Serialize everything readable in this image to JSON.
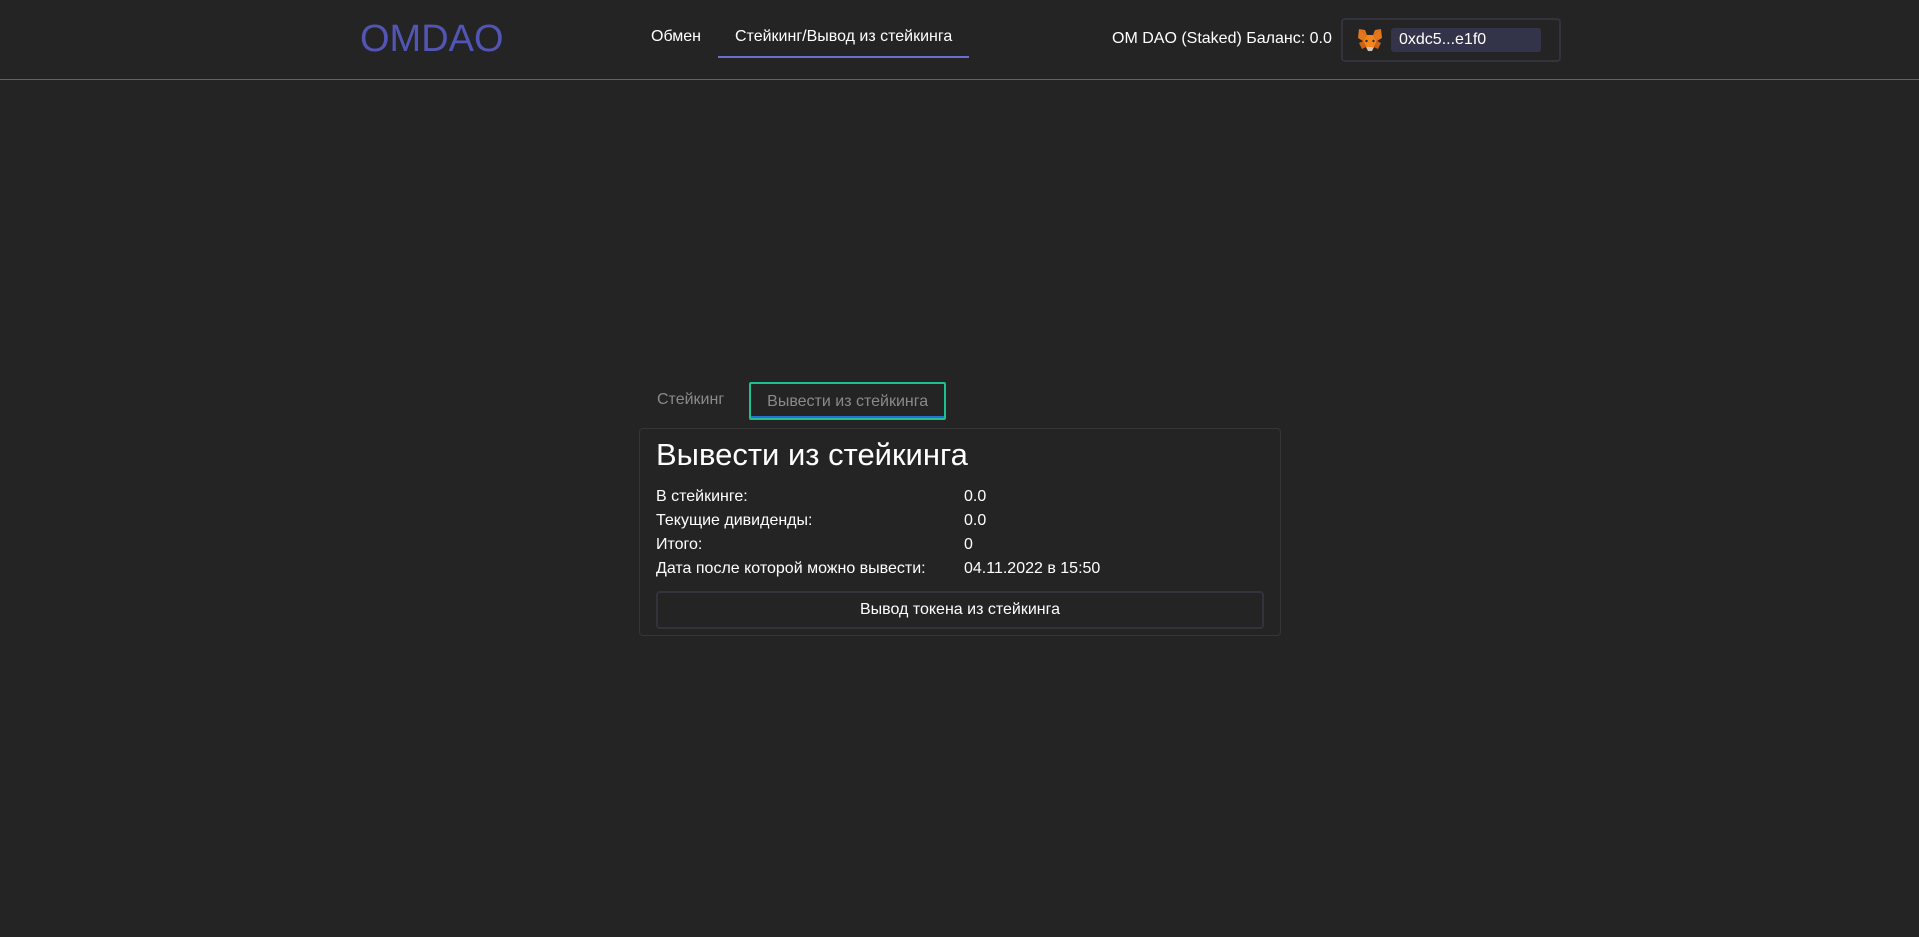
{
  "header": {
    "logo": "OMDAO",
    "nav": [
      {
        "label": "Обмен"
      },
      {
        "label": "Стейкинг/Вывод из стейкинга"
      }
    ],
    "balance_text": "OM DAO (Staked) Баланс: 0.0",
    "wallet": {
      "icon": "metamask-fox-icon",
      "address": "0xdc5...e1f0"
    }
  },
  "tabs": [
    {
      "label": "Стейкинг"
    },
    {
      "label": "Вывести из стейкинга"
    }
  ],
  "card": {
    "title": "Вывести из стейкинга",
    "rows": [
      {
        "label": "В стейкинге:",
        "value": "0.0"
      },
      {
        "label": "Текущие дивиденды:",
        "value": "0.0"
      },
      {
        "label": "Итого:",
        "value": "0"
      },
      {
        "label": "Дата после которой можно вывести:",
        "value": "04.11.2022 в 15:50"
      }
    ],
    "button_label": "Вывод токена из стейкинга"
  },
  "colors": {
    "background": "#242424",
    "logo": "#5255b4",
    "active_tab_border": "#1fc08f",
    "nav_underline": "#6b6fd1"
  }
}
